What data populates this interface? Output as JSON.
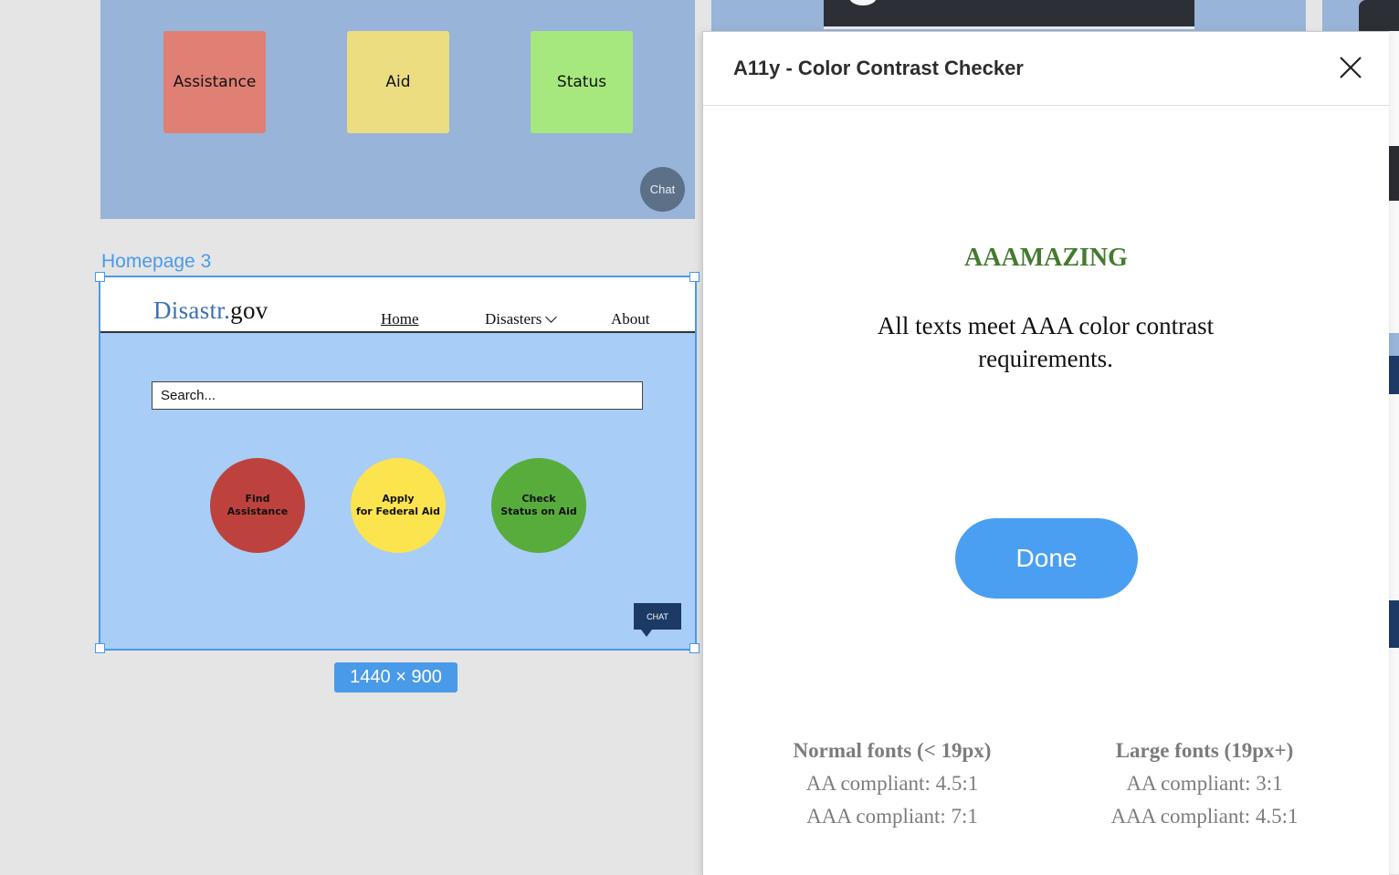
{
  "canvas": {
    "frame1": {
      "tiles": [
        "Assistance",
        "Aid",
        "Status"
      ],
      "chat_label": "Chat"
    },
    "frame3": {
      "label": "Homepage 3",
      "size_badge": "1440 × 900",
      "site": {
        "logo_part1": "Disastr.",
        "logo_part2": "gov",
        "nav": {
          "home": "Home",
          "disasters": "Disasters",
          "about": "About"
        },
        "search_value": "Search...",
        "buttons": {
          "find": "Find\nAssistance",
          "apply": "Apply\nfor Federal Aid",
          "check": "Check\nStatus on Aid"
        },
        "chat_bubble": "CHAT"
      }
    }
  },
  "panel": {
    "title": "A11y - Color Contrast Checker",
    "close_icon": "close-icon",
    "result_heading": "AAAMAZING",
    "result_body": "All texts meet AAA color contrast requirements.",
    "done_label": "Done",
    "normal": {
      "heading": "Normal fonts (< 19px)",
      "aa": "AA compliant: 4.5:1",
      "aaa": "AAA compliant: 7:1"
    },
    "large": {
      "heading": "Large fonts (19px+)",
      "aa": "AA compliant: 3:1",
      "aaa": "AAA compliant: 4.5:1"
    }
  },
  "colors": {
    "accent": "#4a9aea",
    "result_green": "#447a2e",
    "done_button": "#4a9ff2"
  }
}
